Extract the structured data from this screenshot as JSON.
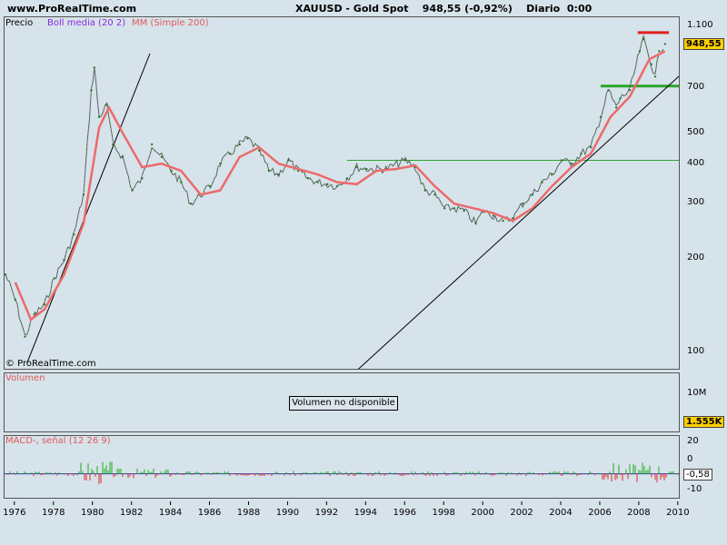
{
  "header": {
    "site": "www.ProRealTime.com",
    "title": "XAUUSD - Gold Spot    948,55 (-0,92%)    Diario  0:00"
  },
  "price_panel": {
    "legend": [
      {
        "label": "Precio",
        "color": "#000000"
      },
      {
        "label": "Boll media (20 2)",
        "color": "#8a2be2"
      },
      {
        "label": "MM (Simple 200)",
        "color": "#e05a5a"
      }
    ],
    "watermark": "© ProRealTime.com",
    "last_price_tag": "948,55",
    "yaxis_labels": [
      "1.100",
      "700",
      "500",
      "400",
      "300",
      "200",
      "100"
    ]
  },
  "volume_panel": {
    "label": "Volumen",
    "message": "Volumen no disponible",
    "yaxis_label": "10M",
    "tag": "1.555K"
  },
  "macd_panel": {
    "label": "MACD-, señal (12 26 9)",
    "yaxis_labels": [
      "20",
      "0",
      "-10"
    ],
    "tag": "-0,58"
  },
  "chart_data": {
    "type": "line",
    "title": "XAUUSD - Gold Spot",
    "x_axis_ticks": [
      "1976",
      "1978",
      "1980",
      "1982",
      "1984",
      "1986",
      "1988",
      "1990",
      "1992",
      "1994",
      "1996",
      "1998",
      "2000",
      "2002",
      "2004",
      "2006",
      "2008",
      "2010"
    ],
    "y_scale": "log",
    "ylim": [
      90,
      1150
    ],
    "series": [
      {
        "name": "Precio",
        "x": [
          1975.5,
          1976.0,
          1976.5,
          1977.0,
          1977.5,
          1978.0,
          1978.5,
          1979.0,
          1979.5,
          1979.9,
          1980.05,
          1980.3,
          1980.7,
          1981.0,
          1981.5,
          1982.0,
          1982.5,
          1983.0,
          1983.5,
          1984.0,
          1984.5,
          1985.0,
          1985.5,
          1986.0,
          1986.5,
          1987.0,
          1987.5,
          1987.9,
          1988.5,
          1989.0,
          1989.5,
          1990.0,
          1990.5,
          1991.0,
          1991.5,
          1992.0,
          1992.5,
          1993.0,
          1993.5,
          1994.0,
          1995.0,
          1996.0,
          1996.5,
          1997.0,
          1997.5,
          1998.0,
          1998.5,
          1999.0,
          1999.6,
          2000.0,
          2000.5,
          2001.0,
          2001.5,
          2002.0,
          2002.5,
          2003.0,
          2003.5,
          2004.0,
          2004.5,
          2005.0,
          2005.5,
          2006.0,
          2006.4,
          2006.8,
          2007.0,
          2007.5,
          2008.0,
          2008.2,
          2008.6,
          2008.8,
          2009.0,
          2009.3
        ],
        "values": [
          180,
          150,
          115,
          135,
          145,
          175,
          200,
          240,
          320,
          680,
          800,
          560,
          610,
          460,
          420,
          330,
          360,
          460,
          420,
          380,
          350,
          300,
          320,
          340,
          400,
          430,
          460,
          480,
          440,
          380,
          370,
          410,
          380,
          360,
          350,
          345,
          340,
          360,
          390,
          385,
          385,
          410,
          390,
          330,
          320,
          290,
          290,
          285,
          260,
          285,
          275,
          265,
          270,
          300,
          320,
          350,
          370,
          410,
          400,
          430,
          450,
          560,
          680,
          600,
          640,
          680,
          900,
          980,
          820,
          750,
          900,
          948.55
        ]
      },
      {
        "name": "MM (Simple 200)",
        "x": [
          1976.0,
          1976.8,
          1977.5,
          1978.5,
          1979.5,
          1980.3,
          1980.8,
          1981.5,
          1982.5,
          1983.5,
          1984.5,
          1985.5,
          1986.5,
          1987.5,
          1988.5,
          1989.5,
          1990.5,
          1991.5,
          1992.5,
          1993.5,
          1994.5,
          1995.5,
          1996.5,
          1997.5,
          1998.5,
          1999.5,
          2000.5,
          2001.5,
          2002.5,
          2003.5,
          2004.5,
          2005.5,
          2006.5,
          2007.5,
          2008.5,
          2009.3
        ],
        "values": [
          170,
          130,
          140,
          180,
          260,
          520,
          600,
          500,
          390,
          400,
          380,
          320,
          330,
          420,
          450,
          400,
          385,
          370,
          350,
          345,
          380,
          385,
          395,
          340,
          300,
          290,
          280,
          265,
          290,
          340,
          390,
          430,
          560,
          650,
          850,
          900
        ]
      }
    ],
    "support_lines": [
      {
        "name": "horizontal 410",
        "value": 410
      },
      {
        "name": "horizontal 700",
        "value": 700
      },
      {
        "name": "horizontal 1030",
        "value": 1030
      }
    ],
    "macd": {
      "name": "MACD-, señal (12 26 9)",
      "ylim": [
        -15,
        22
      ],
      "last": -0.58
    }
  }
}
